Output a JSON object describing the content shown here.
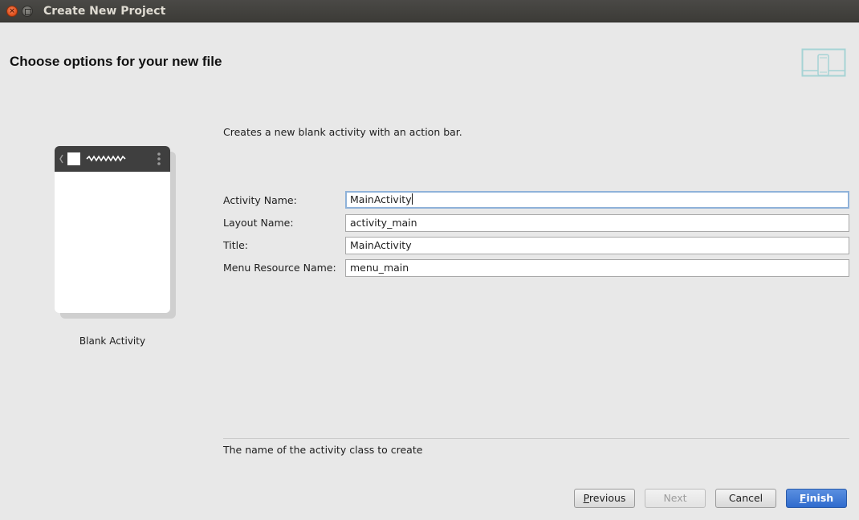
{
  "window": {
    "title": "Create New Project",
    "close_glyph": "×"
  },
  "header": {
    "title": "Choose options for your new file",
    "logo_icon": "device-form-factor-icon",
    "logo_color": "#a6d3d5"
  },
  "preview": {
    "label": "Blank Activity",
    "actionbar_color": "#3f3f3f"
  },
  "description": "Creates a new blank activity with an action bar.",
  "form": {
    "fields": [
      {
        "label": "Activity Name:",
        "value": "MainActivity",
        "focused": true
      },
      {
        "label": "Layout Name:",
        "value": "activity_main"
      },
      {
        "label": "Title:",
        "value": "MainActivity"
      },
      {
        "label": "Menu Resource Name:",
        "value": "menu_main"
      }
    ]
  },
  "hint": "The name of the activity class to create",
  "buttons": {
    "previous": {
      "mnemonic": "P",
      "rest": "revious",
      "enabled": true
    },
    "next": {
      "label": "Next",
      "enabled": false
    },
    "cancel": {
      "label": "Cancel",
      "enabled": true
    },
    "finish": {
      "mnemonic": "F",
      "rest": "inish",
      "enabled": true,
      "color": "#3a76d6"
    }
  }
}
